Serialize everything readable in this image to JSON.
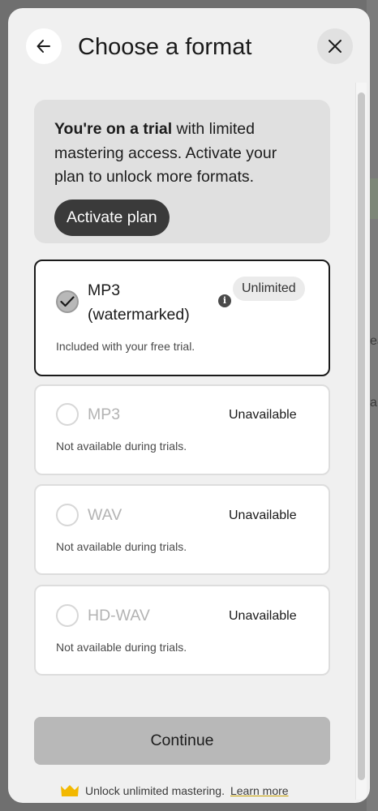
{
  "background": {
    "peek_texts": [
      "ea",
      "a"
    ]
  },
  "header": {
    "title": "Choose a format",
    "back_icon": "arrow-left-icon",
    "close_icon": "close-icon"
  },
  "trial": {
    "bold": "You're on a trial",
    "rest_line1": " with limited",
    "line2": "mastering access. Activate your",
    "line3": "plan to unlock more formats.",
    "activate_label": "Activate plan"
  },
  "options": [
    {
      "name_line1": "MP3",
      "name_line2": "(watermarked)",
      "badge": "Unlimited",
      "desc": "Included with your free trial.",
      "selected": true
    },
    {
      "name": "MP3",
      "status": "Unavailable",
      "desc": "Not available during trials."
    },
    {
      "name": "WAV",
      "status": "Unavailable",
      "desc": "Not available during trials."
    },
    {
      "name": "HD-WAV",
      "status": "Unavailable",
      "desc": "Not available during trials."
    }
  ],
  "continue_label": "Continue",
  "footer": {
    "text": "Unlock unlimited mastering.",
    "link": "Learn more"
  },
  "colors": {
    "overlay": "#6f6f6f",
    "modal": "#f0f0f0",
    "crown": "#f2b800",
    "selected_border": "#1a1a1a"
  }
}
